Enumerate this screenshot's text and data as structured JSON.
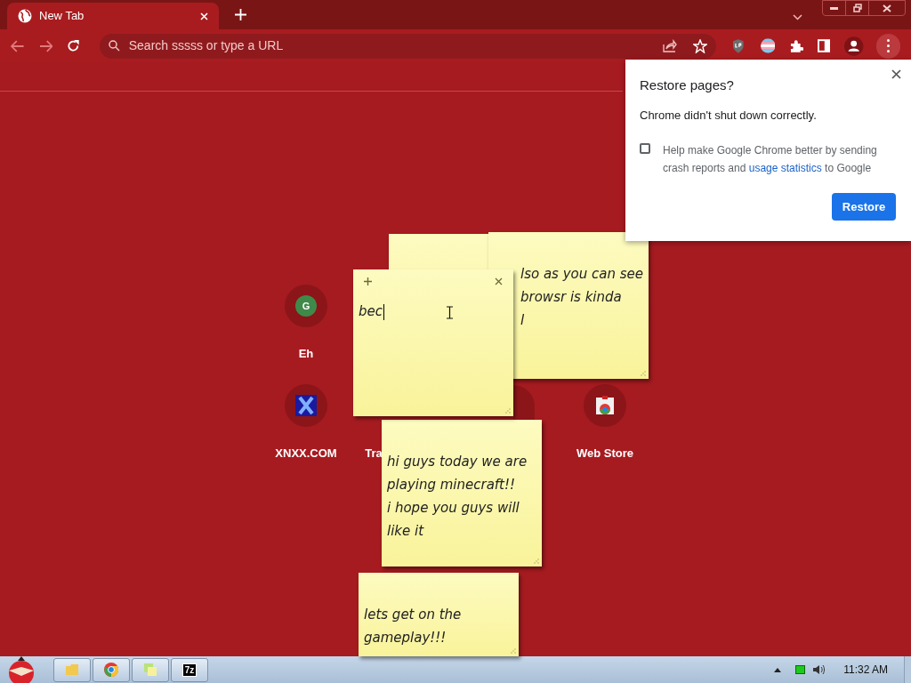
{
  "tab": {
    "title": "New Tab",
    "selected": true
  },
  "omnibox": {
    "placeholder": "Search sssss or type a URL"
  },
  "popup": {
    "title": "Restore pages?",
    "message": "Chrome didn't shut down correctly.",
    "consent": {
      "checked": false,
      "before": "Help make Google Chrome better by sending crash reports and ",
      "link": "usage statistics",
      "after": " to Google"
    },
    "button": "Restore"
  },
  "shortcuts": [
    {
      "label": "Eh",
      "kind": "letter",
      "letter": "G"
    },
    {
      "label": "XNXX.COM",
      "kind": "x"
    },
    {
      "label": "Tra",
      "kind": "hidden"
    },
    {
      "label": "Web Store",
      "kind": "store"
    }
  ],
  "notes": [
    {
      "kind": "blank"
    },
    {
      "kind": "text",
      "text": "lso as you can see\nbrowsr is kinda\nl"
    },
    {
      "kind": "text",
      "text": "bec",
      "focused": true
    },
    {
      "kind": "text",
      "text": "hi guys today we are\nplaying minecraft!!\ni hope you guys will\nlike it"
    },
    {
      "kind": "text",
      "text": "lets get on the\ngameplay!!!"
    }
  ],
  "taskbar": {
    "apps": [
      {
        "kind": "folder"
      },
      {
        "kind": "chrome"
      },
      {
        "kind": "notes"
      },
      {
        "kind": "archive",
        "label": "7z"
      }
    ],
    "clock": "11:32 AM"
  }
}
